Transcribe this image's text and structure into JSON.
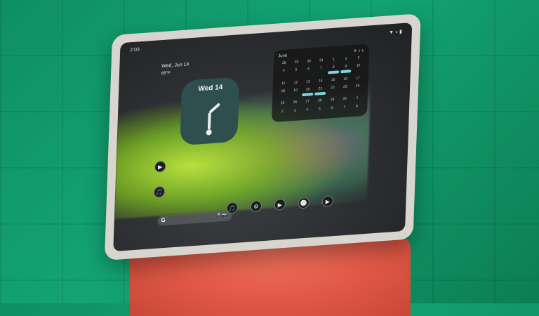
{
  "screen": {
    "status_left": "2:03",
    "status_right": "▼ ◖ ▮",
    "date": "Wed, Jun 14",
    "weather": "68°F",
    "clock_label": "Wed 14",
    "calendar": {
      "month": "June",
      "controls": "+ ‹ ›",
      "days": [
        "28",
        "29",
        "30",
        "31",
        "1",
        "2",
        "3",
        "4",
        "5",
        "6",
        "7",
        "8",
        "9",
        "10",
        "11",
        "12",
        "13",
        "14",
        "15",
        "16",
        "17",
        "18",
        "19",
        "20",
        "21",
        "22",
        "23",
        "24",
        "25",
        "26",
        "27",
        "28",
        "29",
        "30",
        "1",
        "2",
        "3",
        "4",
        "5",
        "6",
        "7",
        "8"
      ]
    },
    "search": {
      "g": "G",
      "mic": "🎤",
      "cam": "📷"
    },
    "dock_icons": [
      "🎵",
      "⚙",
      "▶",
      "⚪",
      "▶"
    ],
    "left_icons": [
      "▶",
      "🎵"
    ]
  }
}
